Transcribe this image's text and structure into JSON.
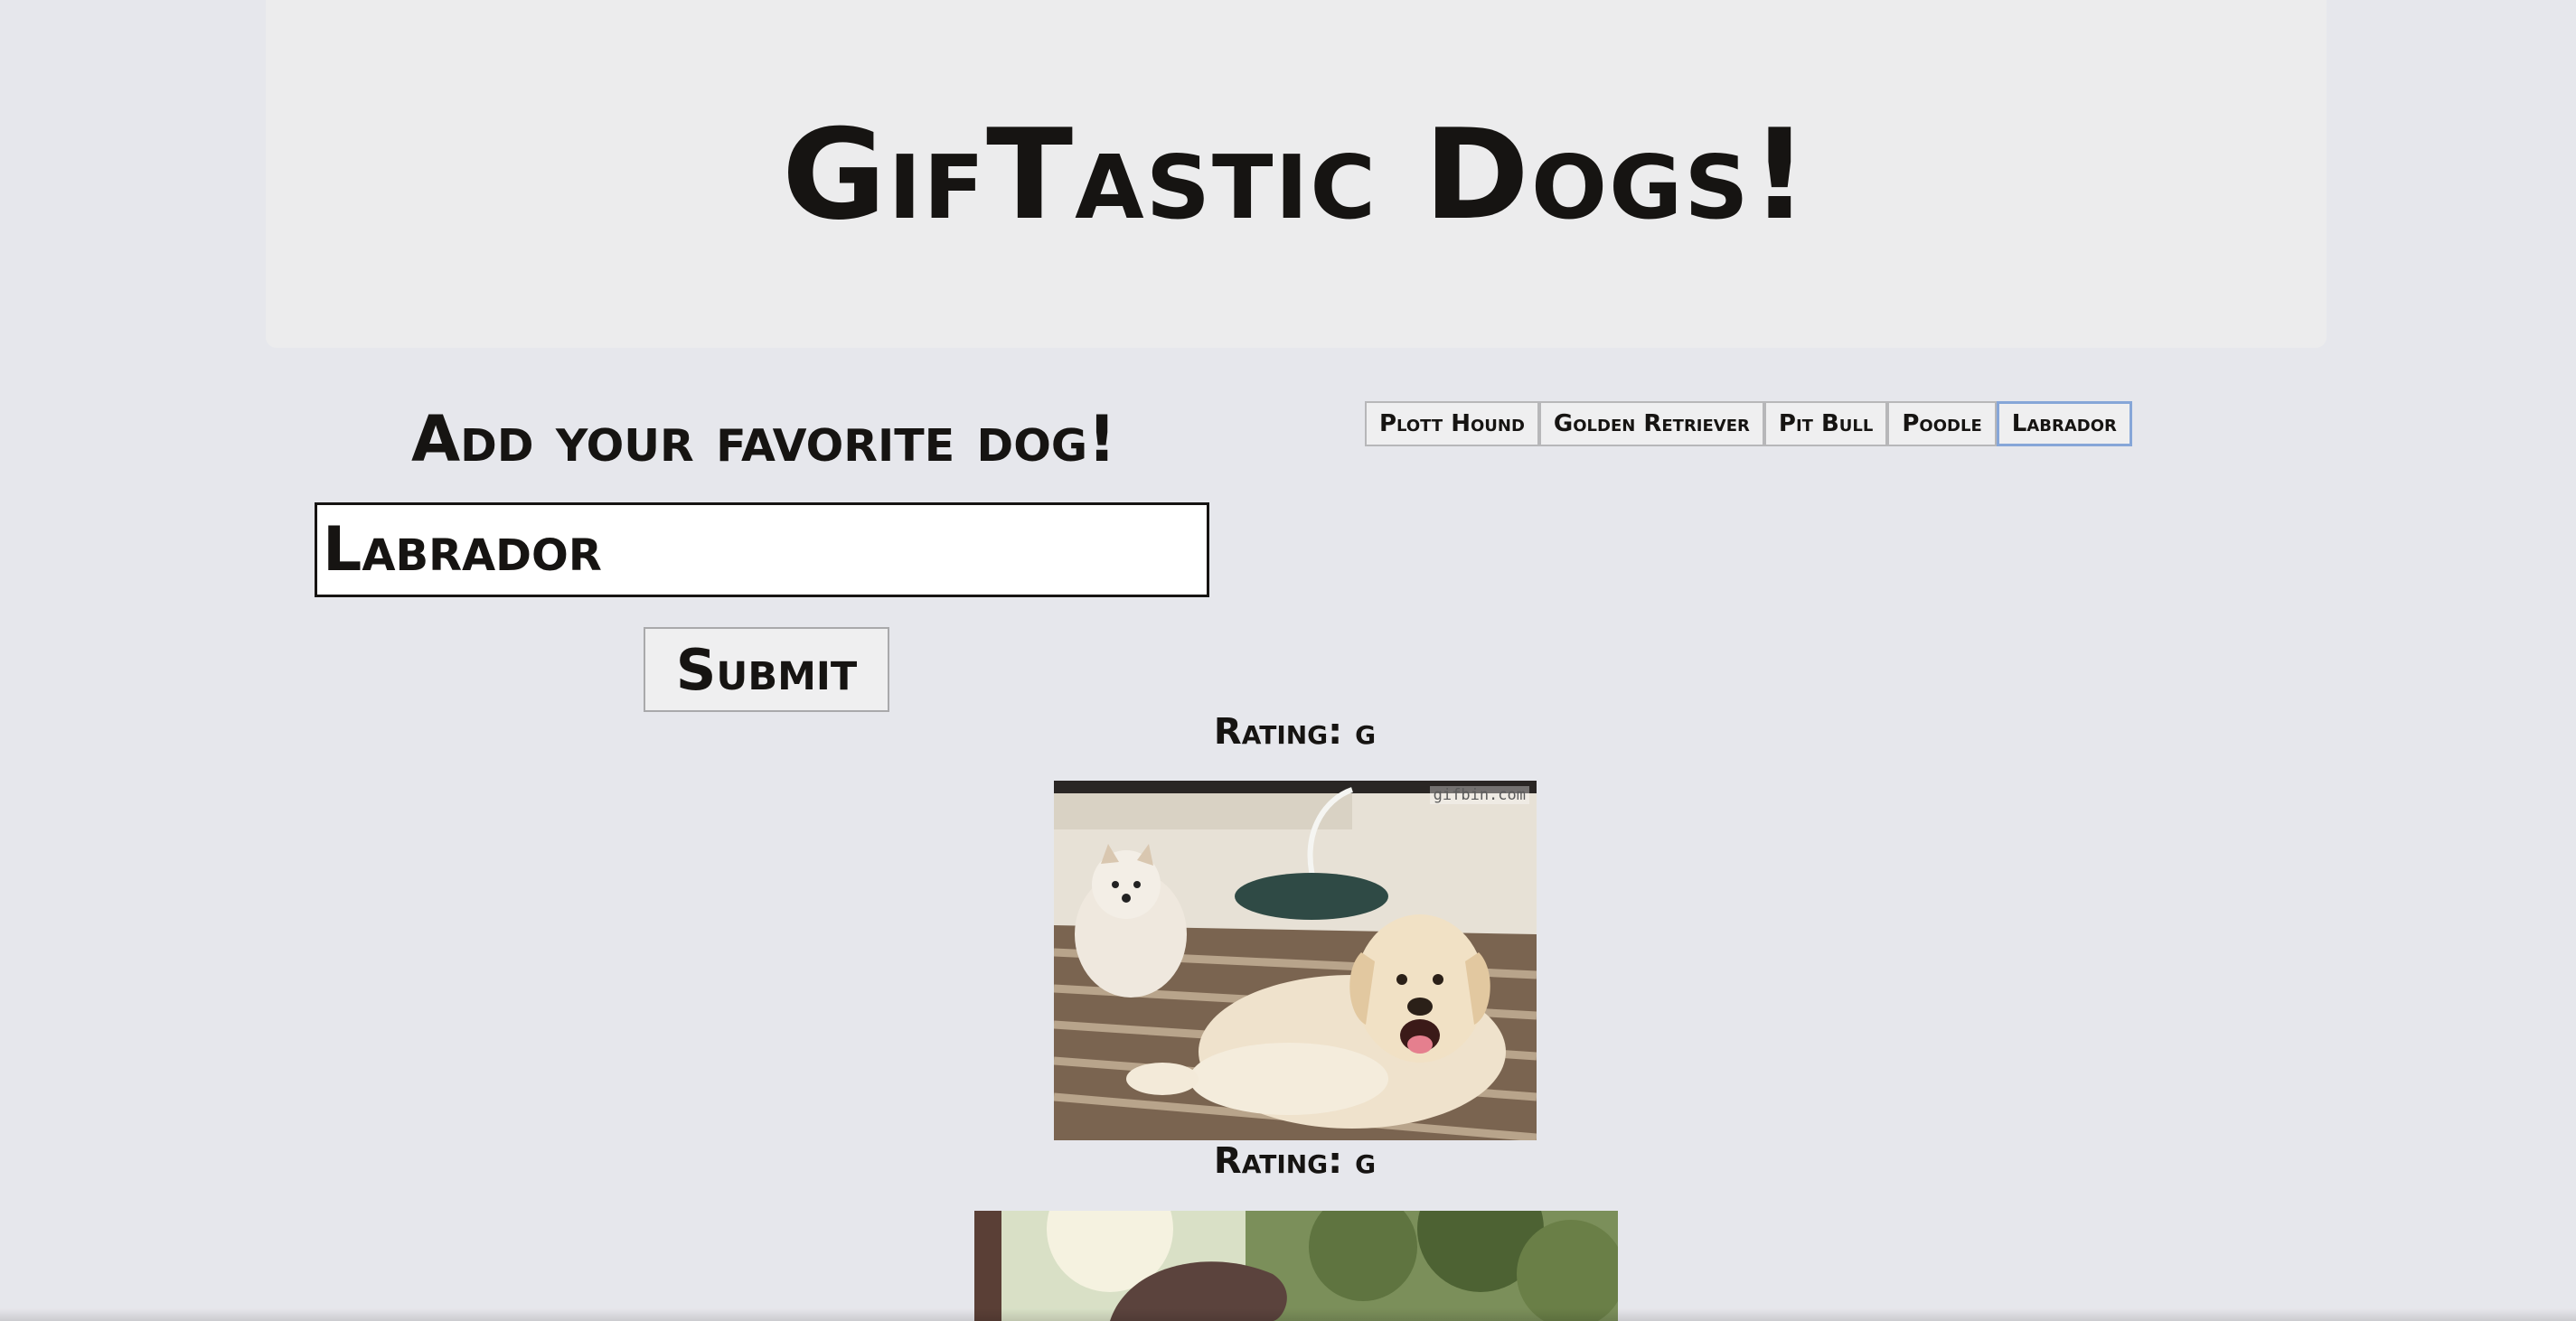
{
  "header": {
    "title": "GifTastic Dogs!"
  },
  "form": {
    "heading": "Add your favorite dog!",
    "input_value": "Labrador",
    "submit_label": "Submit"
  },
  "breed_buttons": [
    {
      "label": "Plott Hound",
      "active": false
    },
    {
      "label": "Golden Retriever",
      "active": false
    },
    {
      "label": "Pit Bull",
      "active": false
    },
    {
      "label": "Poodle",
      "active": false
    },
    {
      "label": "Labrador",
      "active": true
    }
  ],
  "results": [
    {
      "rating": "Rating: g",
      "watermark": "gifbin.com",
      "subject": "labrador and small white dog on striped bed"
    },
    {
      "rating": "Rating: g",
      "subject": "dog outdoors in sunlight with trees"
    }
  ],
  "colors": {
    "page_background": "#e6e7ec",
    "jumbotron_background": "#ececed",
    "text": "#161412",
    "active_button_border": "#86a6d8"
  }
}
